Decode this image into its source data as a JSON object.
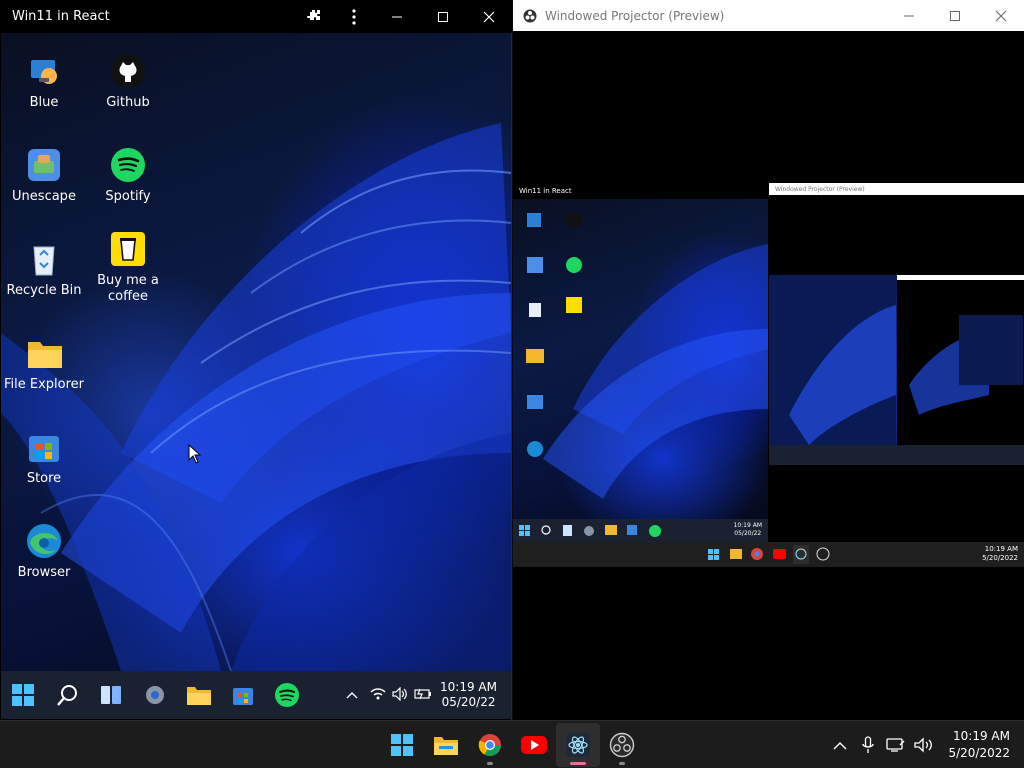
{
  "left_window": {
    "title": "Win11 in React",
    "desktop_icons": [
      {
        "label": "Blue"
      },
      {
        "label": "Github"
      },
      {
        "label": "Unescape"
      },
      {
        "label": "Spotify"
      },
      {
        "label": "Recycle Bin"
      },
      {
        "label": "Buy me a coffee"
      },
      {
        "label": "File Explorer"
      },
      {
        "label": "Store"
      },
      {
        "label": "Browser"
      }
    ],
    "taskbar": {
      "time": "10:19 AM",
      "date": "05/20/22"
    }
  },
  "right_window": {
    "title": "Windowed Projector (Preview)",
    "inner_left_title": "Win11 in React",
    "inner_right_title": "Windowed Projector (Preview)",
    "inner_clock_time": "10:19 AM",
    "inner_clock_date": "5/20/2022",
    "inner_left_clock_time": "10:19 AM",
    "inner_left_clock_date": "05/20/22"
  },
  "taskbar": {
    "apps": [
      "start",
      "file-explorer",
      "chrome",
      "youtube",
      "electron",
      "obs"
    ],
    "time": "10:19 AM",
    "date": "5/20/2022"
  },
  "colors": {
    "accent": "#0f5fd6",
    "taskbar": "#1c1c1c",
    "react_taskbar": "#1a2130"
  }
}
